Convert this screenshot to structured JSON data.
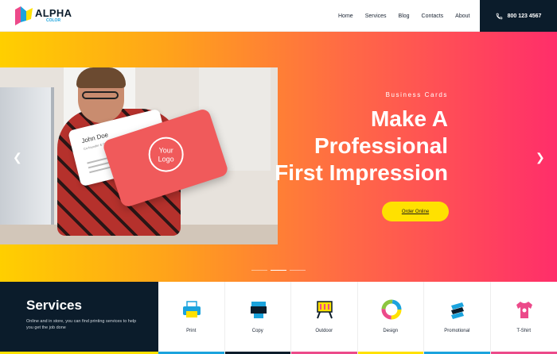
{
  "header": {
    "logo_text": "ALPHA",
    "logo_sub": "COLOR",
    "nav": [
      "Home",
      "Services",
      "Blog",
      "Contacts",
      "About"
    ],
    "phone": "800 123 4567"
  },
  "hero": {
    "kicker": "Business Cards",
    "headline": [
      "Make A",
      "Professional",
      "First Impression"
    ],
    "cta": "Order Online",
    "card_name": "John Doe",
    "card_role": "Co-founder & CEO",
    "seal_line1": "Your",
    "seal_line2": "Logo",
    "prev_icon": "chevron-left-icon",
    "next_icon": "chevron-right-icon",
    "slide_count": 3,
    "active_slide": 2
  },
  "services": {
    "title": "Services",
    "description": "Online and in store, you can find printing services to help you get the job done",
    "items": [
      {
        "label": "Print",
        "icon": "printer-icon",
        "color": "#1ba3dd"
      },
      {
        "label": "Copy",
        "icon": "copier-icon",
        "color": "#0b1c2b"
      },
      {
        "label": "Outdoor",
        "icon": "billboard-icon",
        "color": "#ec4a8a"
      },
      {
        "label": "Design",
        "icon": "color-wheel-icon",
        "color": "#ffe100"
      },
      {
        "label": "Promotional",
        "icon": "stack-icon",
        "color": "#1ba3dd"
      },
      {
        "label": "T-Shirt",
        "icon": "tshirt-icon",
        "color": "#ec4a8a"
      }
    ]
  },
  "colors": {
    "navy": "#0b1c2b",
    "yellow": "#ffe100",
    "pink": "#ff2e6a",
    "orange": "#ffa31a"
  }
}
